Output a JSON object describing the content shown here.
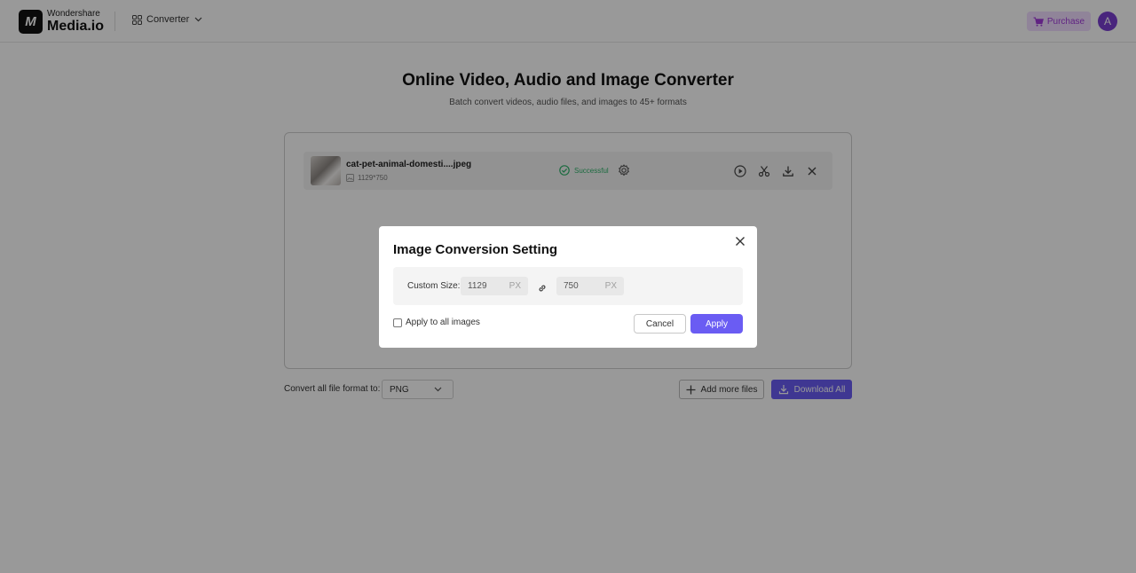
{
  "header": {
    "logo_mark": "M",
    "logo_line1": "Wondershare",
    "logo_line2": "Media.io",
    "nav_converter": "Converter",
    "purchase": "Purchase",
    "avatar_initial": "A"
  },
  "main": {
    "title": "Online Video, Audio and Image Converter",
    "subtitle": "Batch convert videos, audio files, and images to 45+ formats"
  },
  "file": {
    "name": "cat-pet-animal-domesti....jpeg",
    "dimensions": "1129*750",
    "status": "Successful"
  },
  "bottom": {
    "format_label": "Convert all file format to:",
    "format_value": "PNG",
    "add_more": "Add more files",
    "download_all": "Download All"
  },
  "modal": {
    "title": "Image Conversion Setting",
    "custom_size_label": "Custom Size:",
    "width_value": "1129",
    "height_value": "750",
    "unit": "PX",
    "apply_all_label": "Apply to all images",
    "apply_all_checked": false,
    "cancel": "Cancel",
    "apply": "Apply"
  },
  "colors": {
    "accent": "#6a5cf3",
    "success": "#2fb36b",
    "purchase_text": "#a23bdb",
    "avatar_bg": "#7a3fd1"
  },
  "icons": [
    "logo-icon",
    "apps-grid-icon",
    "chevron-down-icon",
    "cart-icon",
    "check-circle-icon",
    "gear-icon",
    "play-icon",
    "scissors-icon",
    "download-icon",
    "close-icon",
    "plus-icon",
    "link-icon",
    "image-icon"
  ]
}
